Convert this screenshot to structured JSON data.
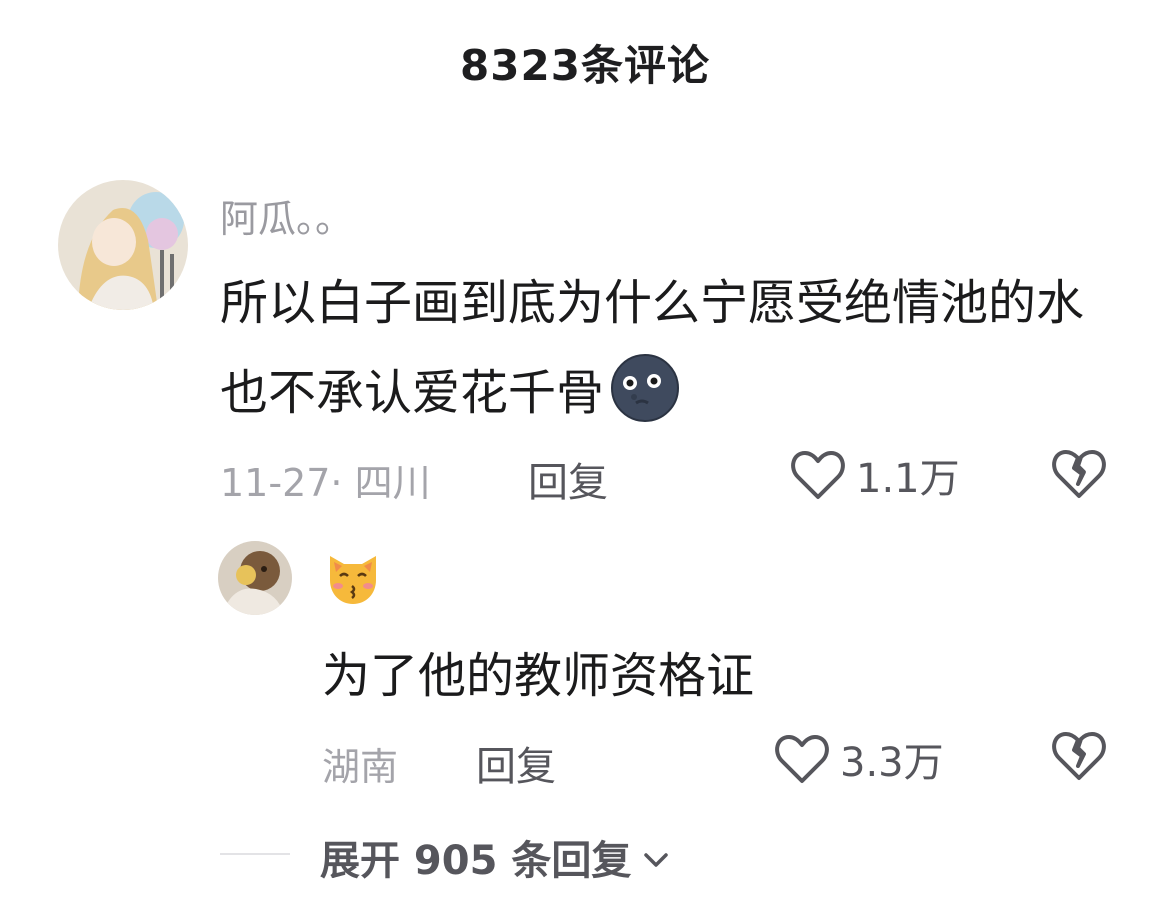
{
  "header": {
    "title": "8323条评论"
  },
  "comment": {
    "username": "阿瓜。。",
    "text": "所以白子画到底为什么宁愿受绝情池的水也不承认爱花千骨",
    "emoji": "new-moon-face-emoji",
    "date_location": "11-27· 四川",
    "reply_label": "回复",
    "likes": "1.1万"
  },
  "reply": {
    "username_emoji": "kissing-cat-emoji",
    "text": "为了他的教师资格证",
    "location": "湖南",
    "reply_label": "回复",
    "likes": "3.3万"
  },
  "expand": {
    "label": "展开 905 条回复"
  },
  "colors": {
    "meta_gray": "#a4a4aa",
    "action_gray": "#56565c",
    "text": "#1b1b1c"
  }
}
